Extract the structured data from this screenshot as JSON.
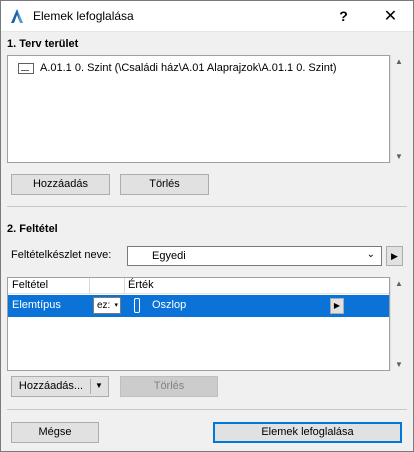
{
  "window": {
    "title": "Elemek lefoglalása",
    "help_label": "?",
    "close_label": "✕"
  },
  "plan_area": {
    "heading": "1. Terv terület",
    "items": [
      {
        "label": "A.01.1 0. Szint (\\Családi ház\\A.01 Alaprajzok\\A.01.1 0. Szint)"
      }
    ],
    "add_label": "Hozzáadás",
    "delete_label": "Törlés"
  },
  "criteria": {
    "heading": "2. Feltétel",
    "set_name_label": "Feltételkészlet neve:",
    "set_name_value": "Egyedi",
    "columns": {
      "condition": "Feltétel",
      "value": "Érték"
    },
    "rows": [
      {
        "condition": "Elemtípus",
        "operator": "ez:",
        "value": "Oszlop"
      }
    ],
    "add_label": "Hozzáadás...",
    "delete_label": "Törlés"
  },
  "footer": {
    "cancel_label": "Mégse",
    "confirm_label": "Elemek lefoglalása"
  },
  "icons": {
    "app": "archicad-logo-icon",
    "plan": "floor-plan-icon",
    "column": "column-element-icon",
    "dropdown": "chevron-down-icon",
    "arrow": "triangle-right-icon"
  },
  "colors": {
    "selection": "#0b73d8",
    "primary_border": "#0078d7"
  }
}
